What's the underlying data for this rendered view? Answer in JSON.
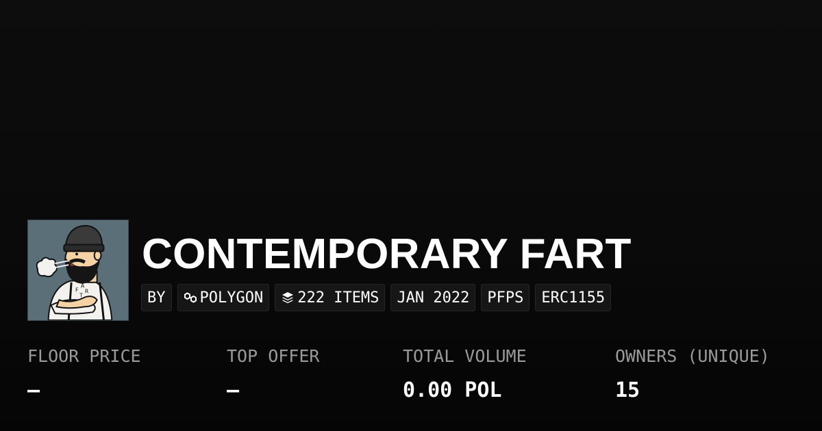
{
  "collection": {
    "title": "CONTEMPORARY FART",
    "thumbnail_icon": "bearded-man-avatar",
    "shirt_letters": [
      "F",
      "A",
      "R",
      "T"
    ]
  },
  "tags": {
    "by": "BY",
    "chain": {
      "label": "POLYGON",
      "icon": "polygon-chain-icon"
    },
    "items": {
      "label": "222 ITEMS",
      "icon": "layers-stack-icon"
    },
    "date": "JAN 2022",
    "category": "PFPS",
    "standard": "ERC1155"
  },
  "stats": {
    "floor_price": {
      "label": "FLOOR PRICE",
      "value": "–"
    },
    "top_offer": {
      "label": "TOP OFFER",
      "value": "–"
    },
    "total_volume": {
      "label": "TOTAL VOLUME",
      "value": "0.00 POL"
    },
    "owners": {
      "label": "OWNERS (UNIQUE)",
      "value": "15"
    }
  },
  "colors": {
    "background": "#0a0a0a",
    "tag_background": "#161616",
    "label_gray": "#9a9a9a",
    "thumbnail_background": "#5b6f78"
  }
}
